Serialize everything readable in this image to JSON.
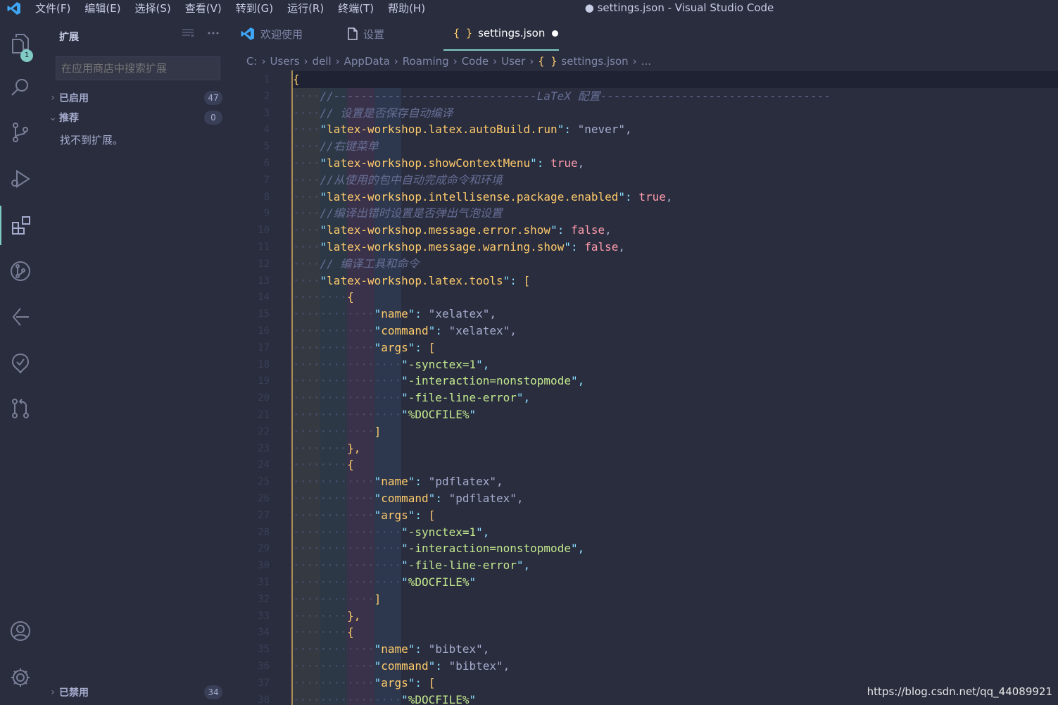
{
  "titlebar": {
    "menu": [
      "文件(F)",
      "编辑(E)",
      "选择(S)",
      "查看(V)",
      "转到(G)",
      "运行(R)",
      "终端(T)",
      "帮助(H)"
    ],
    "window_title": "● settings.json - Visual Studio Code"
  },
  "activitybar": {
    "explorer_badge": "1",
    "icons": [
      "explorer-icon",
      "search-icon",
      "source-control-icon",
      "run-debug-icon",
      "extensions-icon",
      "git-graph-icon",
      "remote-icon",
      "test-icon",
      "pull-request-icon",
      "account-icon",
      "settings-gear-icon"
    ]
  },
  "sidebar": {
    "title": "扩展",
    "search_placeholder": "在应用商店中搜索扩展",
    "sections": {
      "enabled": {
        "label": "已启用",
        "count": "47"
      },
      "recommended": {
        "label": "推荐",
        "count": "0"
      },
      "disabled": {
        "label": "已禁用",
        "count": "34"
      }
    },
    "empty_message": "找不到扩展。"
  },
  "tabs": [
    {
      "label": "欢迎使用",
      "icon": "vscode-logo-icon"
    },
    {
      "label": "设置",
      "icon": "file-icon"
    },
    {
      "label": "settings.json",
      "icon": "json-braces-icon",
      "active": true,
      "dirty": true
    }
  ],
  "breadcrumb": [
    "C:",
    "Users",
    "dell",
    "AppData",
    "Roaming",
    "Code",
    "User",
    "settings.json",
    "..."
  ],
  "editor": {
    "lines": [
      "{",
      "    //------------------------------LaTeX 配置----------------------------------",
      "    // 设置是否保存自动编译",
      "    \"latex-workshop.latex.autoBuild.run\": \"never\",",
      "    //右键菜单",
      "    \"latex-workshop.showContextMenu\": true,",
      "    //从使用的包中自动完成命令和环境",
      "    \"latex-workshop.intellisense.package.enabled\": true,",
      "    //编译出错时设置是否弹出气泡设置",
      "    \"latex-workshop.message.error.show\": false,",
      "    \"latex-workshop.message.warning.show\": false,",
      "    // 编译工具和命令",
      "    \"latex-workshop.latex.tools\": [",
      "        {",
      "            \"name\": \"xelatex\",",
      "            \"command\": \"xelatex\",",
      "            \"args\": [",
      "                \"-synctex=1\",",
      "                \"-interaction=nonstopmode\",",
      "                \"-file-line-error\",",
      "                \"%DOCFILE%\"",
      "            ]",
      "        },",
      "        {",
      "            \"name\": \"pdflatex\",",
      "            \"command\": \"pdflatex\",",
      "            \"args\": [",
      "                \"-synctex=1\",",
      "                \"-interaction=nonstopmode\",",
      "                \"-file-line-error\",",
      "                \"%DOCFILE%\"",
      "            ]",
      "        },",
      "        {",
      "            \"name\": \"bibtex\",",
      "            \"command\": \"bibtex\",",
      "            \"args\": [",
      "                \"%DOCFILE%\""
    ]
  },
  "watermark": "https://blog.csdn.net/qq_44089921",
  "colors": {
    "background": "#292d3e",
    "accent": "#80cbc4",
    "string": "#c3e88d",
    "key": "#c792ea",
    "comment": "#676e95",
    "boolean": "#ff9cac"
  }
}
